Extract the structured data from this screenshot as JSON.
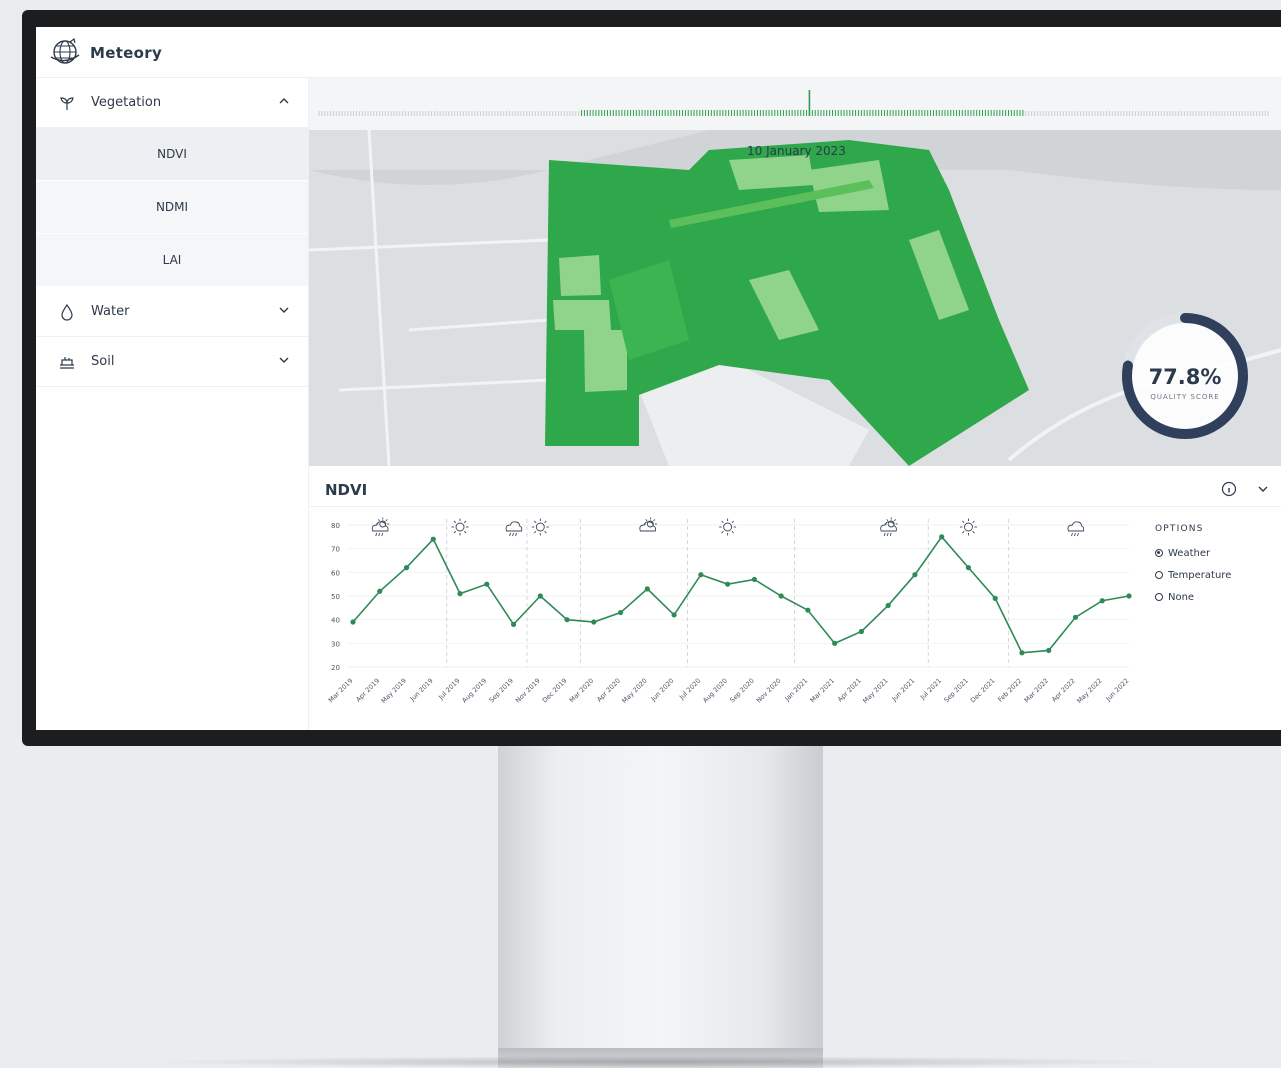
{
  "app": {
    "name": "Meteory"
  },
  "sidebar": {
    "sections": [
      {
        "label": "Vegetation",
        "icon": "plant-icon",
        "expanded": true,
        "items": [
          "NDVI",
          "NDMI",
          "LAI"
        ],
        "active_item": "NDVI"
      },
      {
        "label": "Water",
        "icon": "water-drop-icon",
        "expanded": false
      },
      {
        "label": "Soil",
        "icon": "soil-icon",
        "expanded": false
      }
    ]
  },
  "map": {
    "date": "10 January 2023",
    "quality_score": {
      "value": "77.8%",
      "label": "QUALITY SCORE",
      "fraction": 0.778
    }
  },
  "panel": {
    "title": "NDVI",
    "options": {
      "title": "OPTIONS",
      "items": [
        {
          "label": "Weather",
          "checked": true
        },
        {
          "label": "Temperature",
          "checked": false
        },
        {
          "label": "None",
          "checked": false
        }
      ]
    }
  },
  "chart_data": {
    "type": "line",
    "title": "NDVI",
    "x": [
      "Mar 2019",
      "Apr 2019",
      "May 2019",
      "Jun 2019",
      "Jul 2019",
      "Aug 2019",
      "Sep 2019",
      "Nov 2019",
      "Dec 2019",
      "Mar 2020",
      "Apr 2020",
      "May 2020",
      "Jun 2020",
      "Jul 2020",
      "Aug 2020",
      "Sep 2020",
      "Nov 2020",
      "Jan 2021",
      "Mar 2021",
      "Apr 2021",
      "May 2021",
      "Jun 2021",
      "Jul 2021",
      "Sep 2021",
      "Dec 2021",
      "Feb 2022",
      "Mar 2022",
      "Apr 2022",
      "May 2022",
      "Jun 2022"
    ],
    "series": [
      {
        "values": [
          39,
          52,
          62,
          74,
          51,
          55,
          38,
          50,
          40,
          39,
          43,
          53,
          42,
          59,
          55,
          57,
          50,
          44,
          30,
          35,
          46,
          59,
          75,
          62,
          49,
          26,
          27,
          41,
          48,
          50
        ]
      }
    ],
    "ylim": [
      20,
      80
    ],
    "yticks": [
      20,
      30,
      40,
      50,
      60,
      70,
      80
    ],
    "grid": true,
    "color": "#2e8b57",
    "weather_icons": [
      {
        "at": "Apr 2019",
        "icon": "cloudy-sun-rain-icon"
      },
      {
        "at": "Jul 2019",
        "icon": "sun-icon"
      },
      {
        "at": "Sep 2019",
        "icon": "rain-cloud-icon"
      },
      {
        "at": "Nov 2019",
        "icon": "sun-icon"
      },
      {
        "at": "May 2020",
        "icon": "partly-cloudy-icon"
      },
      {
        "at": "Aug 2020",
        "icon": "sun-icon"
      },
      {
        "at": "May 2021",
        "icon": "cloudy-sun-rain-icon"
      },
      {
        "at": "Sep 2021",
        "icon": "sun-icon"
      },
      {
        "at": "Apr 2022",
        "icon": "rain-cloud-icon"
      }
    ],
    "dividers_after": [
      "Jun 2019",
      "Sep 2019",
      "Dec 2019",
      "Jun 2020",
      "Nov 2020",
      "Jun 2021",
      "Dec 2021"
    ]
  },
  "colors": {
    "accent": "#2d3a4b",
    "field_dark": "#2ea84a",
    "field_light": "#8fd48a",
    "line": "#2e8b57"
  }
}
